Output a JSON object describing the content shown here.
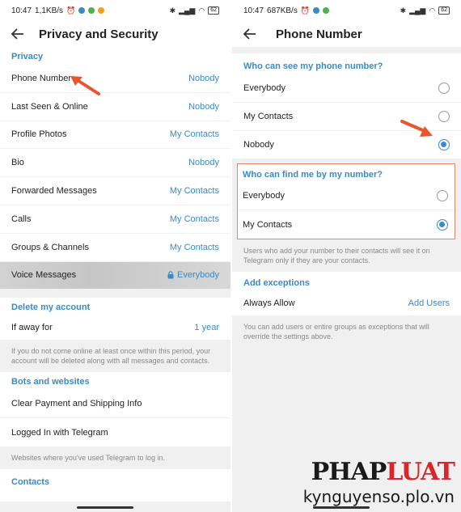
{
  "colors": {
    "accent": "#3a8ac9",
    "annotation": "#e8552e",
    "box_border": "#e0876a"
  },
  "left": {
    "status": {
      "time": "10:47",
      "speed": "1,1KB/s",
      "battery": "62"
    },
    "title": "Privacy and Security",
    "privacy": {
      "header": "Privacy",
      "rows": [
        {
          "label": "Phone Number",
          "value": "Nobody"
        },
        {
          "label": "Last Seen & Online",
          "value": "Nobody"
        },
        {
          "label": "Profile Photos",
          "value": "My Contacts"
        },
        {
          "label": "Bio",
          "value": "Nobody"
        },
        {
          "label": "Forwarded Messages",
          "value": "My Contacts"
        },
        {
          "label": "Calls",
          "value": "My Contacts"
        },
        {
          "label": "Groups & Channels",
          "value": "My Contacts"
        },
        {
          "label": "Voice Messages",
          "value": "Everybody",
          "icon": "lock-icon"
        }
      ]
    },
    "delete_account": {
      "header": "Delete my account",
      "row": {
        "label": "If away for",
        "value": "1 year"
      },
      "note": "If you do not come online at least once within this period, your account will be deleted along with all messages and contacts."
    },
    "bots": {
      "header": "Bots and websites",
      "rows": [
        {
          "label": "Clear Payment and Shipping Info"
        },
        {
          "label": "Logged In with Telegram"
        }
      ],
      "note": "Websites where you've used Telegram to log in."
    },
    "contacts": {
      "header": "Contacts"
    }
  },
  "right": {
    "status": {
      "time": "10:47",
      "speed": "687KB/s",
      "battery": "62"
    },
    "title": "Phone Number",
    "who_see": {
      "header": "Who can see my phone number?",
      "options": [
        {
          "label": "Everybody",
          "selected": false
        },
        {
          "label": "My Contacts",
          "selected": false
        },
        {
          "label": "Nobody",
          "selected": true
        }
      ]
    },
    "who_find": {
      "header": "Who can find me by my number?",
      "options": [
        {
          "label": "Everybody",
          "selected": false
        },
        {
          "label": "My Contacts",
          "selected": true
        }
      ]
    },
    "find_note": "Users who add your number to their contacts will see it on Telegram only if they are your contacts.",
    "exceptions": {
      "header": "Add exceptions",
      "row": {
        "label": "Always Allow",
        "value": "Add Users"
      },
      "note": "You can add users or entire groups as exceptions that will override the settings above."
    }
  },
  "watermark": {
    "logo_a": "PHAP",
    "logo_b": "LUAT",
    "url": "kynguyenso.plo.vn"
  }
}
